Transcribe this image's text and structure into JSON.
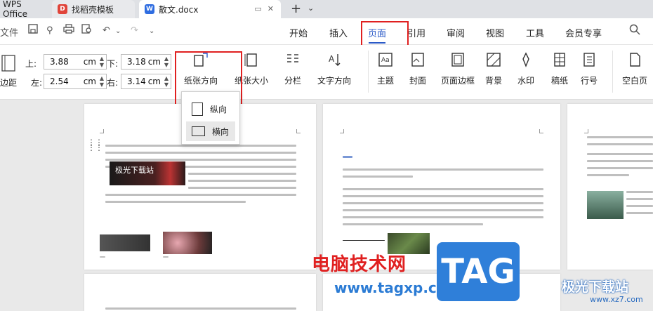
{
  "tabs": [
    {
      "label": "WPS Office"
    },
    {
      "label": "找稻壳模板"
    },
    {
      "label": "散文.docx"
    }
  ],
  "quick": {
    "file": "文件"
  },
  "menu": [
    {
      "label": "开始"
    },
    {
      "label": "插入"
    },
    {
      "label": "页面"
    },
    {
      "label": "引用"
    },
    {
      "label": "审阅"
    },
    {
      "label": "视图"
    },
    {
      "label": "工具"
    },
    {
      "label": "会员专享"
    }
  ],
  "margins": {
    "top_label": "上:",
    "top_value": "3.88",
    "bottom_label": "下:",
    "bottom_value": "3.18",
    "left_label": "左:",
    "left_value": "2.54",
    "right_label": "右:",
    "right_value": "3.14",
    "unit": "cm",
    "margin_button": "边距"
  },
  "ribbon": {
    "orientation": "纸张方向",
    "size": "纸张大小",
    "columns": "分栏",
    "direction": "文字方向",
    "theme": "主题",
    "cover": "封面",
    "border": "页面边框",
    "background": "背景",
    "watermark": "水印",
    "draft": "稿纸",
    "lineno": "行号",
    "blank": "空白页"
  },
  "orientation_menu": {
    "portrait": "纵向",
    "landscape": "横向"
  },
  "doc": {
    "image_caption": "极光下载站"
  },
  "watermark": {
    "site_cn": "电脑技术网",
    "site_url": "www.tagxp.com",
    "tag": "TAG",
    "logo_text": "极光下载站",
    "logo_url": "www.xz7.com"
  }
}
